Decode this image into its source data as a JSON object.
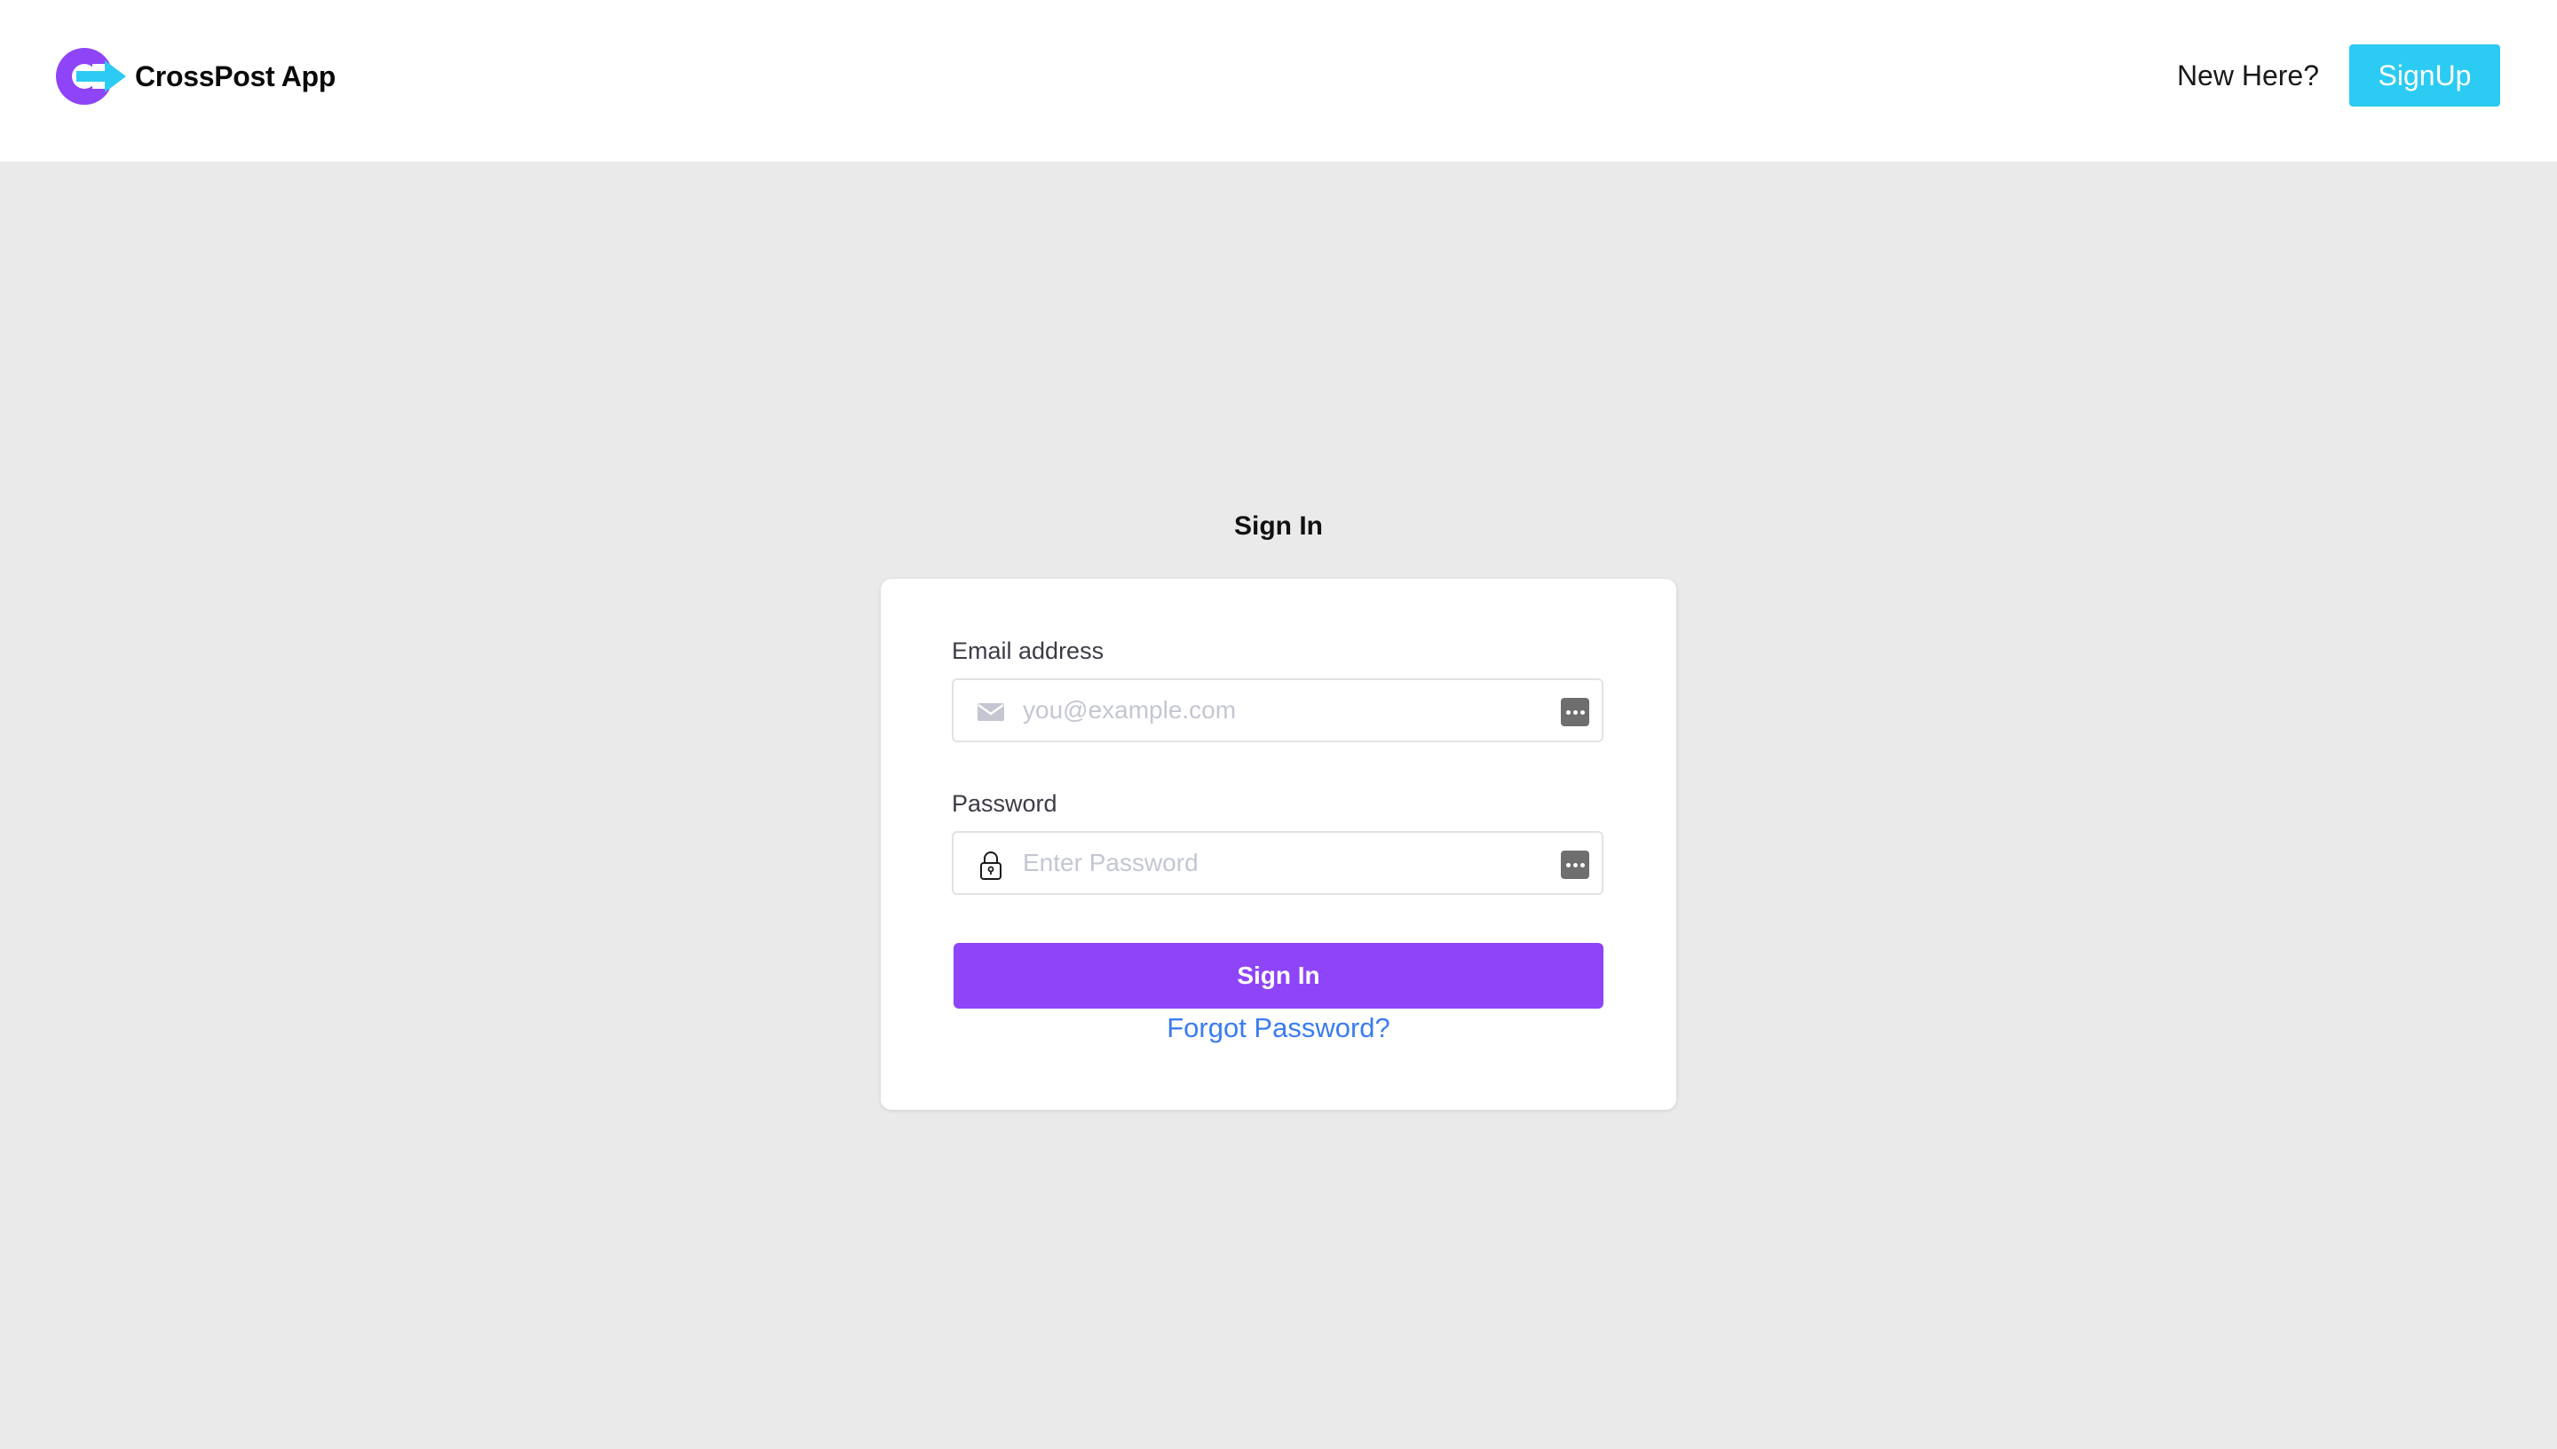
{
  "header": {
    "app_name": "CrossPost App",
    "new_here_text": "New Here?",
    "signup_label": "SignUp"
  },
  "signin": {
    "title": "Sign In",
    "email": {
      "label": "Email address",
      "placeholder": "you@example.com",
      "value": ""
    },
    "password": {
      "label": "Password",
      "placeholder": "Enter Password",
      "value": ""
    },
    "submit_label": "Sign In",
    "forgot_label": "Forgot Password?"
  },
  "icons": {
    "logo": "crosspost-logo-icon",
    "email": "envelope-icon",
    "password": "lock-icon",
    "password_manager": "password-manager-icon"
  },
  "colors": {
    "page_background": "#eaeaea",
    "header_background": "#ffffff",
    "signup_button": "#2ccbf3",
    "signin_button": "#8e44f7",
    "link": "#3a7cf0",
    "logo_purple": "#8e44f7",
    "logo_cyan": "#2ccbf3"
  }
}
